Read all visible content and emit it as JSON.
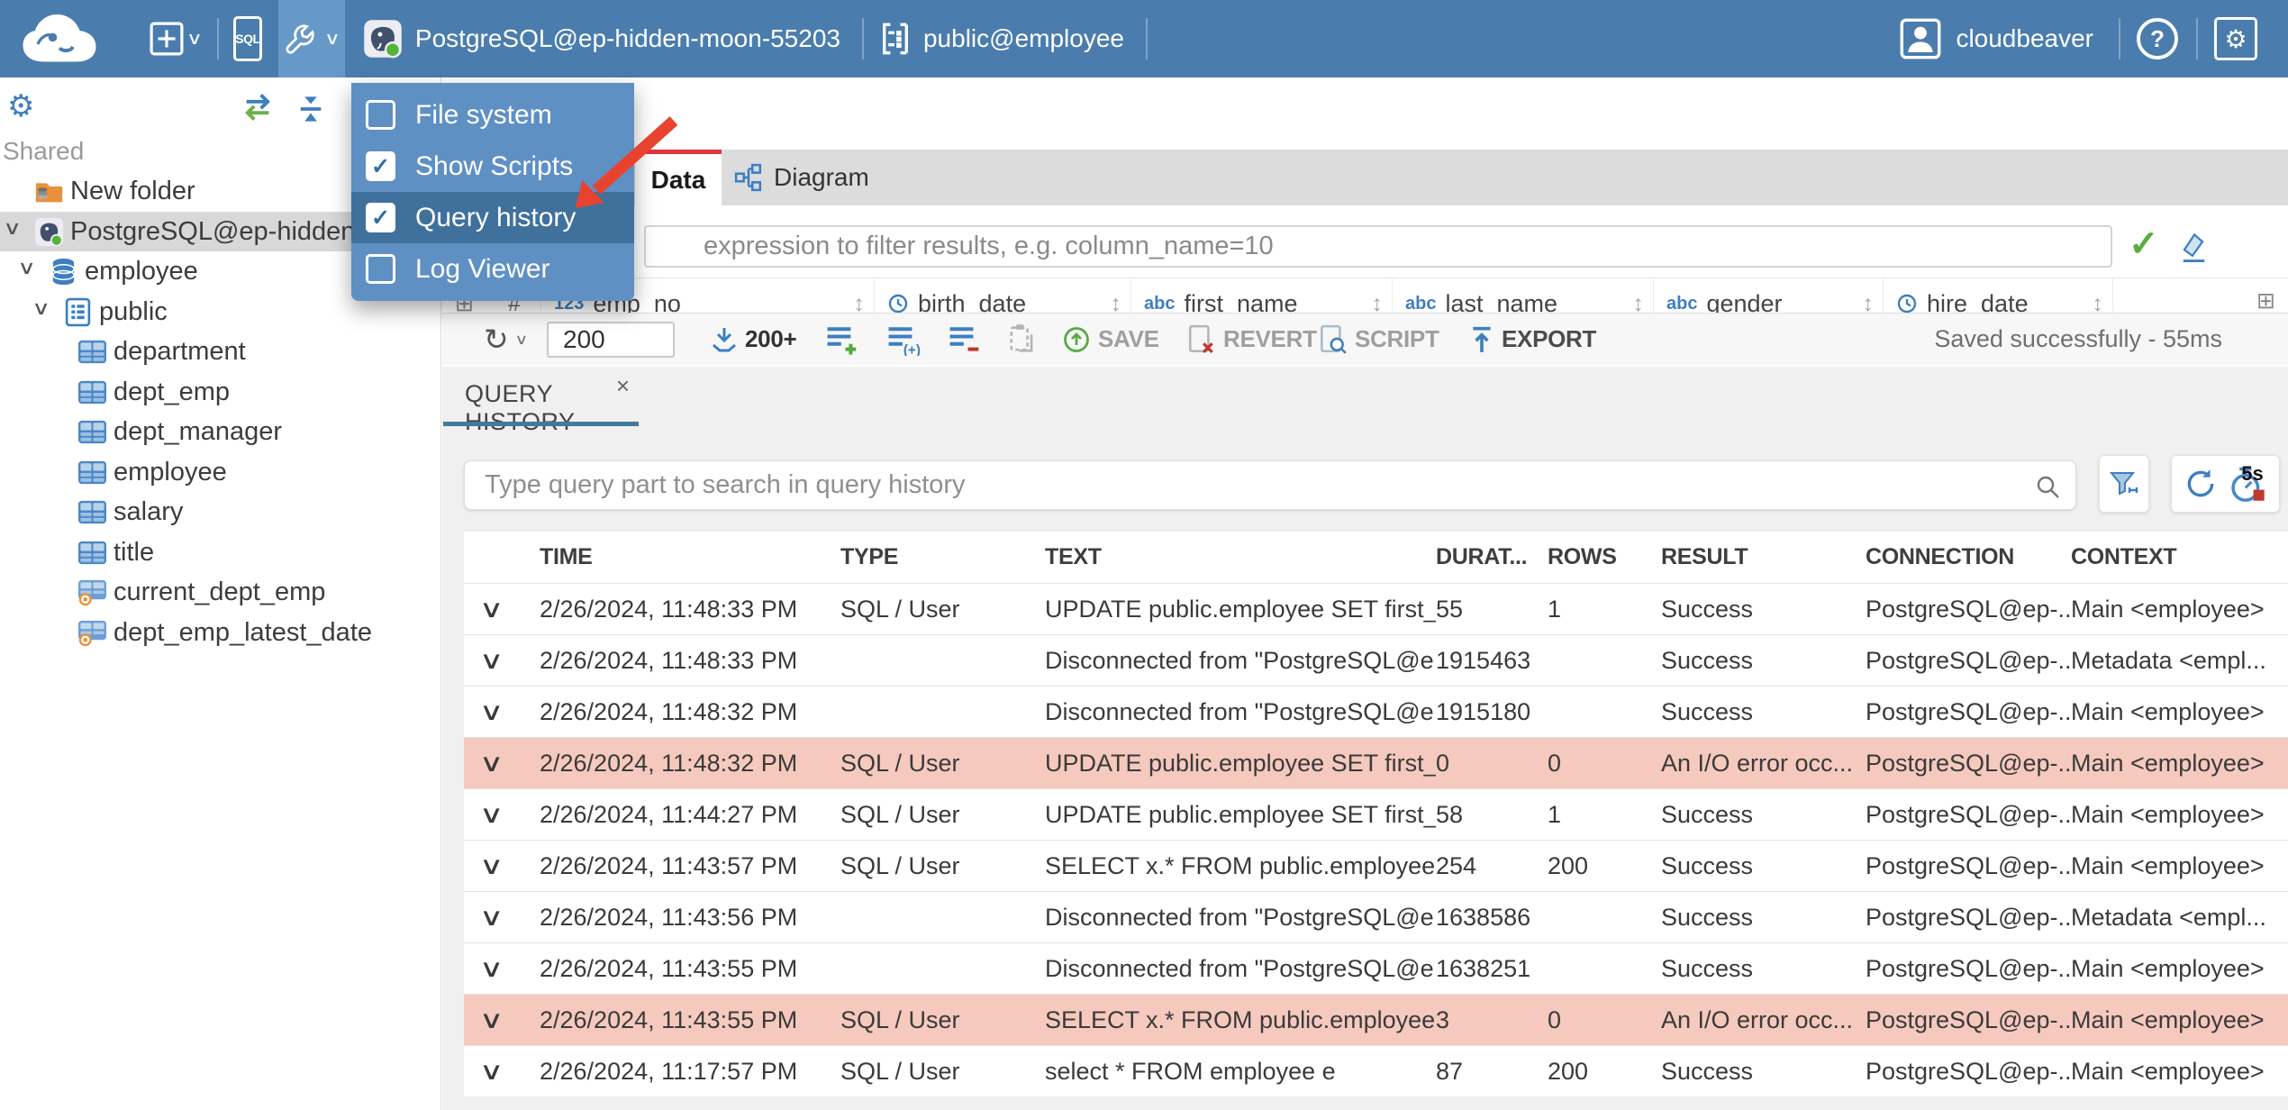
{
  "topbar": {
    "connection": "PostgreSQL@ep-hidden-moon-55203",
    "schema_selector": "public@employee",
    "sql_button": "SQL",
    "user": "cloudbeaver"
  },
  "dropdown": {
    "items": [
      {
        "label": "File system",
        "checked": false,
        "selected": false
      },
      {
        "label": "Show Scripts",
        "checked": true,
        "selected": false
      },
      {
        "label": "Query history",
        "checked": true,
        "selected": true
      },
      {
        "label": "Log Viewer",
        "checked": false,
        "selected": false
      }
    ]
  },
  "annotation": {
    "arrow_color": "#e8432e",
    "points_to": "Query history"
  },
  "sidebar": {
    "section": "Shared",
    "tree": [
      {
        "label": "New folder",
        "icon": "folder-db",
        "level": 0,
        "chevron": false,
        "selected": false
      },
      {
        "label": "PostgreSQL@ep-hidden-moon-55203",
        "icon": "postgres",
        "level": 0,
        "chevron": true,
        "selected": true
      },
      {
        "label": "employee",
        "icon": "database",
        "level": 1,
        "chevron": true,
        "selected": false
      },
      {
        "label": "public",
        "icon": "schema",
        "level": 2,
        "chevron": true,
        "selected": false
      },
      {
        "label": "department",
        "icon": "table",
        "level": 3,
        "chevron": false,
        "selected": false
      },
      {
        "label": "dept_emp",
        "icon": "table",
        "level": 3,
        "chevron": false,
        "selected": false
      },
      {
        "label": "dept_manager",
        "icon": "table",
        "level": 3,
        "chevron": false,
        "selected": false
      },
      {
        "label": "employee",
        "icon": "table",
        "level": 3,
        "chevron": false,
        "selected": false
      },
      {
        "label": "salary",
        "icon": "table",
        "level": 3,
        "chevron": false,
        "selected": false
      },
      {
        "label": "title",
        "icon": "table",
        "level": 3,
        "chevron": false,
        "selected": false
      },
      {
        "label": "current_dept_emp",
        "icon": "view",
        "level": 3,
        "chevron": false,
        "selected": false
      },
      {
        "label": "dept_emp_latest_date",
        "icon": "view",
        "level": 3,
        "chevron": false,
        "selected": false
      }
    ]
  },
  "tabs": {
    "data": "Data",
    "diagram": "Diagram"
  },
  "filter": {
    "placeholder": "expression to filter results, e.g. column_name=10"
  },
  "data_grid": {
    "row_header": "#",
    "columns": [
      {
        "label": "emp_no",
        "type": "num"
      },
      {
        "label": "birth_date",
        "type": "date"
      },
      {
        "label": "first_name",
        "type": "text"
      },
      {
        "label": "last_name",
        "type": "text"
      },
      {
        "label": "gender",
        "type": "text"
      },
      {
        "label": "hire_date",
        "type": "date"
      }
    ]
  },
  "toolbar": {
    "row_limit": "200",
    "fetch_more": "200+",
    "save": "SAVE",
    "revert": "REVERT",
    "script": "SCRIPT",
    "export": "EXPORT",
    "status": "Saved successfully - 55ms"
  },
  "query_history": {
    "tab_label": "QUERY HISTORY",
    "search_placeholder": "Type query part to search in query history",
    "timer_badge": "5s",
    "columns": [
      "TIME",
      "TYPE",
      "TEXT",
      "DURAT...",
      "ROWS",
      "RESULT",
      "CONNECTION",
      "CONTEXT"
    ],
    "rows": [
      {
        "time": "2/26/2024, 11:48:33 PM",
        "type": "SQL / User",
        "text": "UPDATE public.employee SET first_...",
        "duration": "55",
        "rows": "1",
        "result": "Success",
        "connection": "PostgreSQL@ep-...",
        "context": "Main <employee>",
        "error": false
      },
      {
        "time": "2/26/2024, 11:48:33 PM",
        "type": "",
        "text": "Disconnected from \"PostgreSQL@e...",
        "duration": "1915463",
        "rows": "",
        "result": "Success",
        "connection": "PostgreSQL@ep-...",
        "context": "Metadata <empl...",
        "error": false
      },
      {
        "time": "2/26/2024, 11:48:32 PM",
        "type": "",
        "text": "Disconnected from \"PostgreSQL@e...",
        "duration": "1915180",
        "rows": "",
        "result": "Success",
        "connection": "PostgreSQL@ep-...",
        "context": "Main <employee>",
        "error": false
      },
      {
        "time": "2/26/2024, 11:48:32 PM",
        "type": "SQL / User",
        "text": "UPDATE public.employee SET first_...",
        "duration": "0",
        "rows": "0",
        "result": "An I/O error occ...",
        "connection": "PostgreSQL@ep-...",
        "context": "Main <employee>",
        "error": true
      },
      {
        "time": "2/26/2024, 11:44:27 PM",
        "type": "SQL / User",
        "text": "UPDATE public.employee SET first_...",
        "duration": "58",
        "rows": "1",
        "result": "Success",
        "connection": "PostgreSQL@ep-...",
        "context": "Main <employee>",
        "error": false
      },
      {
        "time": "2/26/2024, 11:43:57 PM",
        "type": "SQL / User",
        "text": "SELECT x.* FROM public.employee x",
        "duration": "254",
        "rows": "200",
        "result": "Success",
        "connection": "PostgreSQL@ep-...",
        "context": "Main <employee>",
        "error": false
      },
      {
        "time": "2/26/2024, 11:43:56 PM",
        "type": "",
        "text": "Disconnected from \"PostgreSQL@e...",
        "duration": "1638586",
        "rows": "",
        "result": "Success",
        "connection": "PostgreSQL@ep-...",
        "context": "Metadata <empl...",
        "error": false
      },
      {
        "time": "2/26/2024, 11:43:55 PM",
        "type": "",
        "text": "Disconnected from \"PostgreSQL@e...",
        "duration": "1638251",
        "rows": "",
        "result": "Success",
        "connection": "PostgreSQL@ep-...",
        "context": "Main <employee>",
        "error": false
      },
      {
        "time": "2/26/2024, 11:43:55 PM",
        "type": "SQL / User",
        "text": "SELECT x.* FROM public.employee x",
        "duration": "3",
        "rows": "0",
        "result": "An I/O error occ...",
        "connection": "PostgreSQL@ep-...",
        "context": "Main <employee>",
        "error": true
      },
      {
        "time": "2/26/2024, 11:17:57 PM",
        "type": "SQL / User",
        "text": "select * FROM employee e",
        "duration": "87",
        "rows": "200",
        "result": "Success",
        "connection": "PostgreSQL@ep-...",
        "context": "Main <employee>",
        "error": false
      }
    ]
  }
}
